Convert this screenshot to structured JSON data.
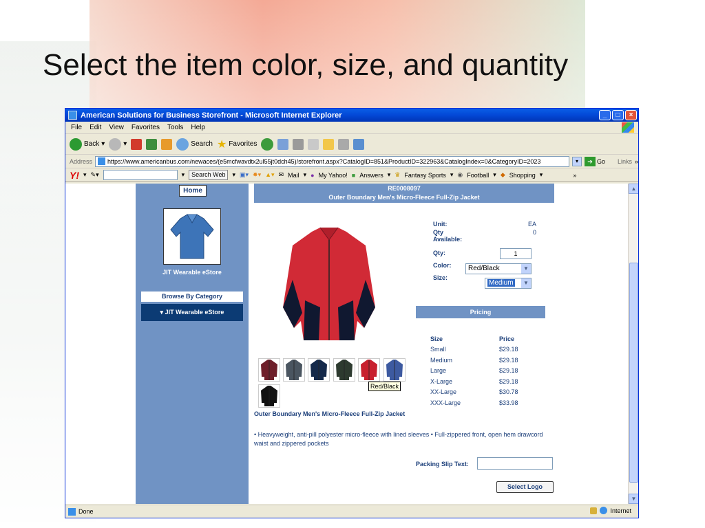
{
  "slide": {
    "title": "Select the item color, size, and quantity"
  },
  "window": {
    "title": "American Solutions for Business Storefront - Microsoft Internet Explorer"
  },
  "menu": [
    "File",
    "Edit",
    "View",
    "Favorites",
    "Tools",
    "Help"
  ],
  "toolbar": {
    "back": "Back",
    "search": "Search",
    "favorites": "Favorites"
  },
  "address": {
    "label": "Address",
    "url": "https://www.americanbus.com/newaces/(e5mcfwavdtx2ul55jt0dch45)/storefront.aspx?CatalogID=851&ProductID=322963&CatalogIndex=0&CategoryID=2023",
    "go": "Go",
    "links": "Links"
  },
  "yahoo": {
    "logo": "Y!",
    "search_btn": "Search Web",
    "mail": "Mail",
    "my_yahoo": "My Yahoo!",
    "answers": "Answers",
    "fantasy": "Fantasy Sports",
    "football": "Football",
    "shopping": "Shopping"
  },
  "sidebar": {
    "home": "Home",
    "store_name": "JIT Wearable eStore",
    "browse_heading": "Browse By Category",
    "category": "▾ JIT Wearable eStore"
  },
  "product": {
    "sku": "RE0008097",
    "name": "Outer Boundary Men's Micro-Fleece Full-Zip Jacket",
    "unit_label": "Unit:",
    "unit_value": "EA",
    "qty_avail_label": "Qty Available:",
    "qty_avail_value": "0",
    "qty_label": "Qty:",
    "qty_value": "1",
    "color_label": "Color:",
    "color_value": "Red/Black",
    "size_label": "Size:",
    "size_value": "Medium",
    "tooltip": "Red/Black",
    "description_title": "Outer Boundary Men's Micro-Fleece Full-Zip Jacket",
    "description": "• Heavyweight, anti-pill polyester micro-fleece with lined sleeves • Full-zippered front, open hem drawcord waist and zippered pockets",
    "packing_label": "Packing Slip Text:",
    "select_logo": "Select Logo"
  },
  "pricing": {
    "heading": "Pricing",
    "col_size": "Size",
    "col_price": "Price",
    "rows": [
      {
        "size": "Small",
        "price": "$29.18"
      },
      {
        "size": "Medium",
        "price": "$29.18"
      },
      {
        "size": "Large",
        "price": "$29.18"
      },
      {
        "size": "X-Large",
        "price": "$29.18"
      },
      {
        "size": "XX-Large",
        "price": "$30.78"
      },
      {
        "size": "XXX-Large",
        "price": "$33.98"
      }
    ]
  },
  "swatch_colors": [
    "#6e1f2a",
    "#4a5560",
    "#14294a",
    "#2d3a2f",
    "#c8202e",
    "#3d5aa0",
    "#111111"
  ],
  "status": {
    "left": "Done",
    "zone": "Internet"
  }
}
